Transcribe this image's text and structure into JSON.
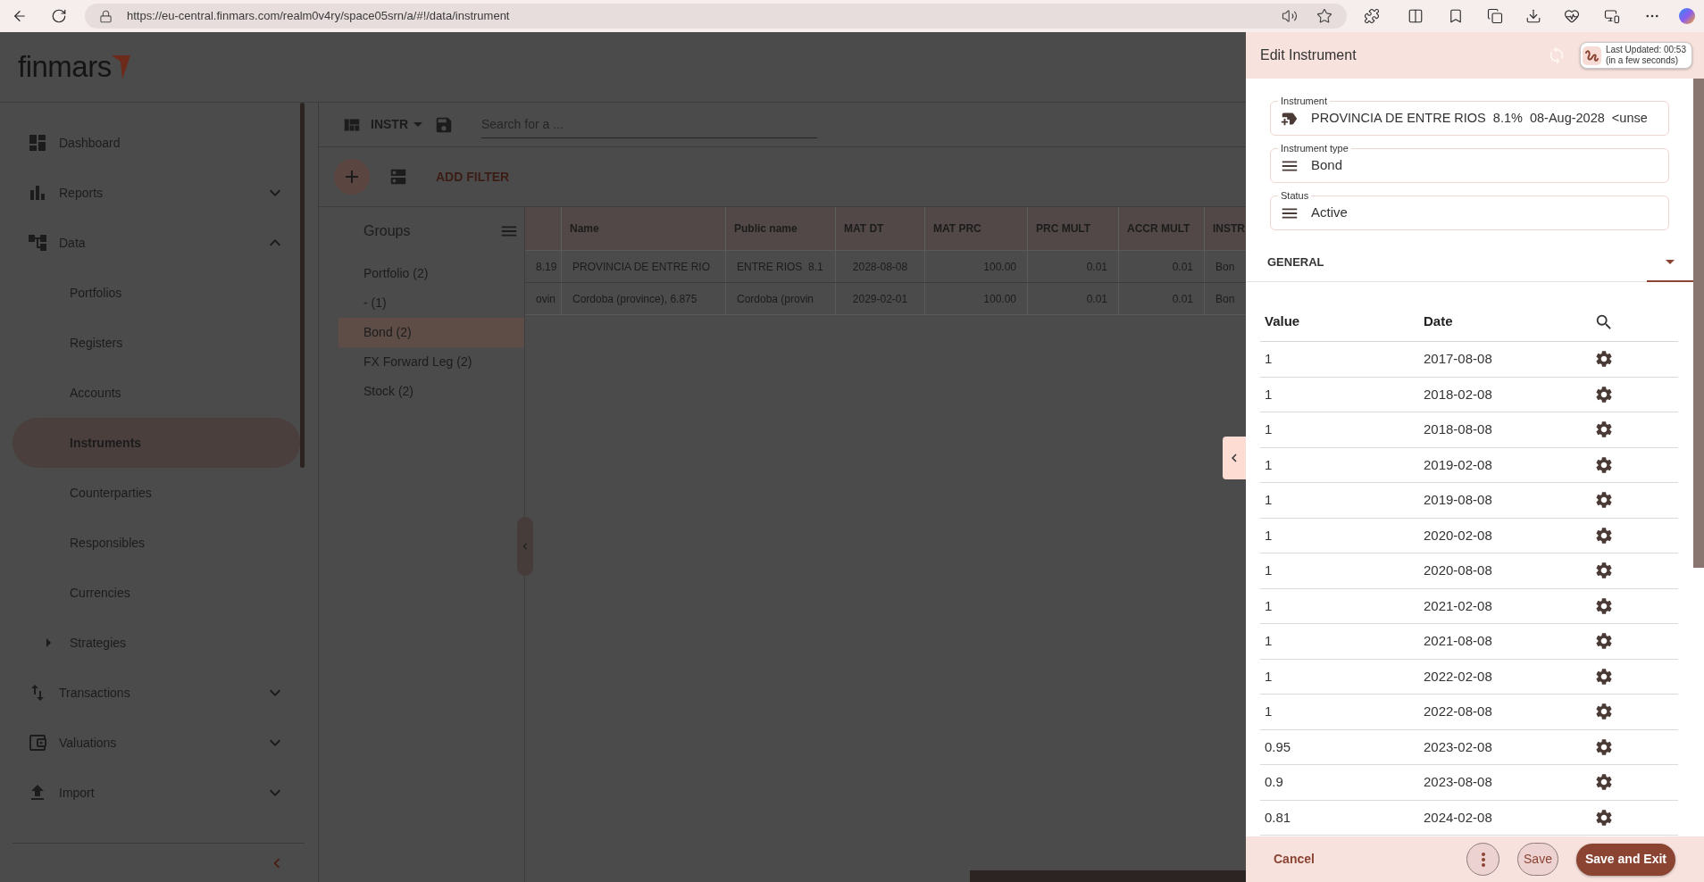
{
  "browser": {
    "url": "https://eu-central.finmars.com/realm0v4ry/space05srn/a/#!/data/instrument"
  },
  "logo": {
    "text": "finmars"
  },
  "sidebar": {
    "items": [
      {
        "label": "Dashboard",
        "selected": false
      },
      {
        "label": "Reports",
        "selected": false,
        "expanded": false
      },
      {
        "label": "Data",
        "selected": false,
        "expanded": true,
        "children": [
          {
            "label": "Portfolios",
            "selected": false
          },
          {
            "label": "Registers",
            "selected": false
          },
          {
            "label": "Accounts",
            "selected": false
          },
          {
            "label": "Instruments",
            "selected": true
          },
          {
            "label": "Counterparties",
            "selected": false
          },
          {
            "label": "Responsibles",
            "selected": false
          },
          {
            "label": "Currencies",
            "selected": false
          },
          {
            "label": "Strategies",
            "selected": false,
            "expanded": false
          }
        ]
      },
      {
        "label": "Transactions",
        "selected": false,
        "expanded": false
      },
      {
        "label": "Valuations",
        "selected": false,
        "expanded": false
      },
      {
        "label": "Import",
        "selected": false,
        "expanded": false
      }
    ]
  },
  "toolbar": {
    "layout": "INSTR",
    "search": {
      "placeholder": "Search for a ..."
    },
    "add_filter": "ADD FILTER"
  },
  "groups": {
    "title": "Groups",
    "items": [
      {
        "label": "Portfolio (2)",
        "selected": false
      },
      {
        "label": "- (1)",
        "selected": false
      },
      {
        "label": "Bond (2)",
        "selected": true
      },
      {
        "label": "FX Forward Leg (2)",
        "selected": false
      },
      {
        "label": "Stock (2)",
        "selected": false
      }
    ]
  },
  "table": {
    "columns": [
      {
        "kind": "text"
      },
      {
        "kind": "text",
        "label": "Name"
      },
      {
        "kind": "text",
        "label": "Public name"
      },
      {
        "kind": "date",
        "label": "MAT DT"
      },
      {
        "kind": "number",
        "label": "MAT PRC"
      },
      {
        "kind": "number",
        "label": "PRC MULT"
      },
      {
        "kind": "number",
        "label": "ACCR MULT"
      },
      {
        "kind": "text",
        "label": "INSTR"
      }
    ],
    "rows": [
      {
        "cells": [
          "8.19",
          "PROVINCIA DE ENTRE RIO",
          "ENTRE RIOS  8.1",
          "2028-08-08",
          "100.00",
          "0.01",
          "0.01",
          "Bon"
        ]
      },
      {
        "cells": [
          "ovin",
          "Cordoba (province), 6.875",
          "Cordoba (provin",
          "2029-02-01",
          "100.00",
          "0.01",
          "0.01",
          "Bon"
        ]
      }
    ]
  },
  "edit_panel": {
    "title": "Edit Instrument",
    "last_updated": [
      "Last Updated: 00:53",
      "(in a few seconds)"
    ],
    "fields": [
      {
        "kind": "instrument",
        "label": "Instrument",
        "value": "PROVINCIA DE ENTRE RIOS  8.1%  08-Aug-2028  <unse"
      },
      {
        "kind": "select",
        "label": "Instrument type",
        "value": "Bond"
      },
      {
        "kind": "select",
        "label": "Status",
        "value": "Active"
      }
    ],
    "section": "GENERAL",
    "table": {
      "columns": [
        "Value",
        "Date"
      ],
      "rows": [
        {
          "value": "1",
          "date": "2017-08-08"
        },
        {
          "value": "1",
          "date": "2018-02-08"
        },
        {
          "value": "1",
          "date": "2018-08-08"
        },
        {
          "value": "1",
          "date": "2019-02-08"
        },
        {
          "value": "1",
          "date": "2019-08-08"
        },
        {
          "value": "1",
          "date": "2020-02-08"
        },
        {
          "value": "1",
          "date": "2020-08-08"
        },
        {
          "value": "1",
          "date": "2021-02-08"
        },
        {
          "value": "1",
          "date": "2021-08-08"
        },
        {
          "value": "1",
          "date": "2022-02-08"
        },
        {
          "value": "1",
          "date": "2022-08-08"
        },
        {
          "value": "0.95",
          "date": "2023-02-08"
        },
        {
          "value": "0.9",
          "date": "2023-08-08"
        },
        {
          "value": "0.81",
          "date": "2024-02-08"
        }
      ]
    },
    "footer": {
      "buttons": [
        {
          "kind": "text",
          "label": "Cancel"
        },
        {
          "kind": "more"
        },
        {
          "kind": "outlined",
          "label": "Save"
        },
        {
          "kind": "filled",
          "label": "Save and Exit"
        }
      ]
    }
  }
}
